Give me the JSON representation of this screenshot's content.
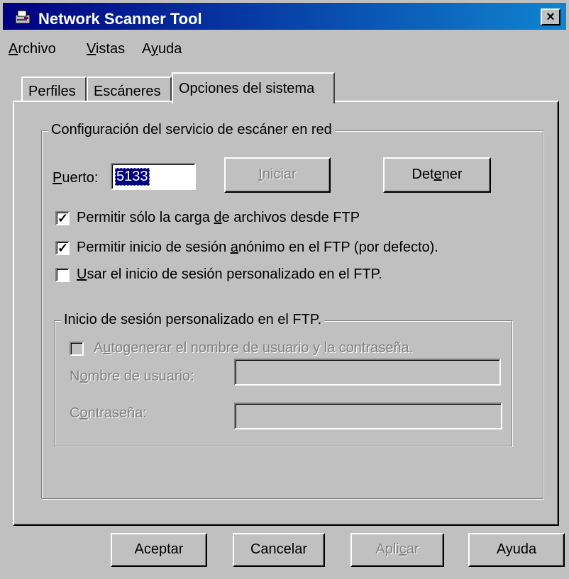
{
  "window": {
    "title": "Network Scanner Tool",
    "close_glyph": "×"
  },
  "menu": [
    {
      "pre": "",
      "key": "A",
      "post": "rchivo"
    },
    {
      "pre": "",
      "key": "V",
      "post": "istas"
    },
    {
      "pre": "A",
      "key": "y",
      "post": "uda"
    }
  ],
  "tabs": [
    "Perfiles",
    "Escáneres",
    "Opciones del sistema"
  ],
  "service_group": {
    "legend": "Configuración del servicio de escáner en red",
    "port_label_key": "P",
    "port_label_rest": "uerto:",
    "port_value": "5133",
    "start_button_pre": "",
    "start_button_key": "I",
    "start_button_post": "niciar",
    "stop_button_pre": "Det",
    "stop_button_key": "e",
    "stop_button_post": "ner"
  },
  "checkboxes": [
    {
      "pre": "Permitir sólo la carga ",
      "key": "d",
      "post": "e archivos desde FTP",
      "checked": true
    },
    {
      "pre": "Permitir inicio de sesión ",
      "key": "a",
      "post": "nónimo en el FTP (por  defecto).",
      "checked": true
    },
    {
      "pre": "",
      "key": "U",
      "post": "sar el inicio de sesión personalizado en el FTP.",
      "checked": false
    }
  ],
  "custom_group": {
    "legend": "Inicio de sesión personalizado en el FTP.",
    "autogen_pre": "A",
    "autogen_key": "u",
    "autogen_post": "togenerar el nombre de usuario y la contraseña.",
    "username_pre": "N",
    "username_key": "o",
    "username_post": "mbre de usuario:",
    "password_pre": "C",
    "password_key": "o",
    "password_post": "ntraseña:"
  },
  "footer_buttons": {
    "ok": "Aceptar",
    "cancel": "Cancelar",
    "apply_pre": "Apli",
    "apply_key": "c",
    "apply_post": "ar",
    "help": "Ayuda"
  }
}
